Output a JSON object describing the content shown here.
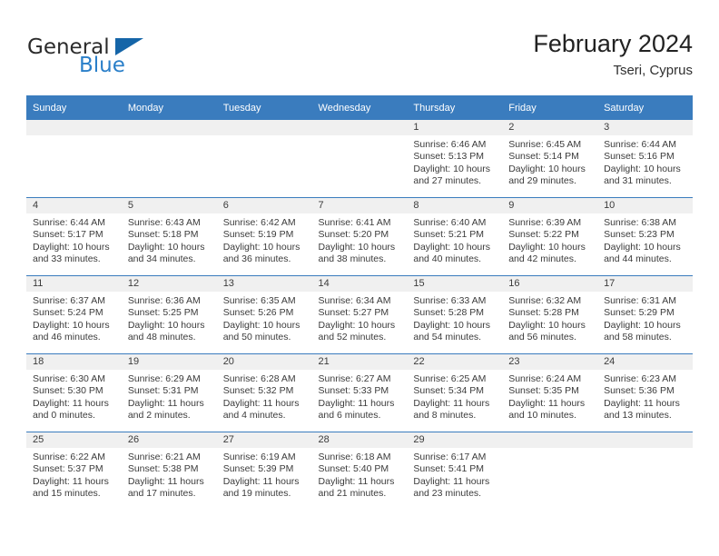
{
  "brand": {
    "word_one": "General",
    "word_two": "Blue",
    "logo_icon": "triangle-logo-icon",
    "accent_color": "#2a7fc9",
    "triangle_color": "#1565a8"
  },
  "header": {
    "title": "February 2024",
    "location": "Tseri, Cyprus"
  },
  "calendar": {
    "header_bg": "#3a7cbe",
    "daynum_bg": "#f0f0f0",
    "weekdays": [
      "Sunday",
      "Monday",
      "Tuesday",
      "Wednesday",
      "Thursday",
      "Friday",
      "Saturday"
    ],
    "weeks": [
      [
        {
          "day": "",
          "blank": true
        },
        {
          "day": "",
          "blank": true
        },
        {
          "day": "",
          "blank": true
        },
        {
          "day": "",
          "blank": true
        },
        {
          "day": "1",
          "sunrise": "Sunrise: 6:46 AM",
          "sunset": "Sunset: 5:13 PM",
          "daylight_line1": "Daylight: 10 hours",
          "daylight_line2": "and 27 minutes."
        },
        {
          "day": "2",
          "sunrise": "Sunrise: 6:45 AM",
          "sunset": "Sunset: 5:14 PM",
          "daylight_line1": "Daylight: 10 hours",
          "daylight_line2": "and 29 minutes."
        },
        {
          "day": "3",
          "sunrise": "Sunrise: 6:44 AM",
          "sunset": "Sunset: 5:16 PM",
          "daylight_line1": "Daylight: 10 hours",
          "daylight_line2": "and 31 minutes."
        }
      ],
      [
        {
          "day": "4",
          "sunrise": "Sunrise: 6:44 AM",
          "sunset": "Sunset: 5:17 PM",
          "daylight_line1": "Daylight: 10 hours",
          "daylight_line2": "and 33 minutes."
        },
        {
          "day": "5",
          "sunrise": "Sunrise: 6:43 AM",
          "sunset": "Sunset: 5:18 PM",
          "daylight_line1": "Daylight: 10 hours",
          "daylight_line2": "and 34 minutes."
        },
        {
          "day": "6",
          "sunrise": "Sunrise: 6:42 AM",
          "sunset": "Sunset: 5:19 PM",
          "daylight_line1": "Daylight: 10 hours",
          "daylight_line2": "and 36 minutes."
        },
        {
          "day": "7",
          "sunrise": "Sunrise: 6:41 AM",
          "sunset": "Sunset: 5:20 PM",
          "daylight_line1": "Daylight: 10 hours",
          "daylight_line2": "and 38 minutes."
        },
        {
          "day": "8",
          "sunrise": "Sunrise: 6:40 AM",
          "sunset": "Sunset: 5:21 PM",
          "daylight_line1": "Daylight: 10 hours",
          "daylight_line2": "and 40 minutes."
        },
        {
          "day": "9",
          "sunrise": "Sunrise: 6:39 AM",
          "sunset": "Sunset: 5:22 PM",
          "daylight_line1": "Daylight: 10 hours",
          "daylight_line2": "and 42 minutes."
        },
        {
          "day": "10",
          "sunrise": "Sunrise: 6:38 AM",
          "sunset": "Sunset: 5:23 PM",
          "daylight_line1": "Daylight: 10 hours",
          "daylight_line2": "and 44 minutes."
        }
      ],
      [
        {
          "day": "11",
          "sunrise": "Sunrise: 6:37 AM",
          "sunset": "Sunset: 5:24 PM",
          "daylight_line1": "Daylight: 10 hours",
          "daylight_line2": "and 46 minutes."
        },
        {
          "day": "12",
          "sunrise": "Sunrise: 6:36 AM",
          "sunset": "Sunset: 5:25 PM",
          "daylight_line1": "Daylight: 10 hours",
          "daylight_line2": "and 48 minutes."
        },
        {
          "day": "13",
          "sunrise": "Sunrise: 6:35 AM",
          "sunset": "Sunset: 5:26 PM",
          "daylight_line1": "Daylight: 10 hours",
          "daylight_line2": "and 50 minutes."
        },
        {
          "day": "14",
          "sunrise": "Sunrise: 6:34 AM",
          "sunset": "Sunset: 5:27 PM",
          "daylight_line1": "Daylight: 10 hours",
          "daylight_line2": "and 52 minutes."
        },
        {
          "day": "15",
          "sunrise": "Sunrise: 6:33 AM",
          "sunset": "Sunset: 5:28 PM",
          "daylight_line1": "Daylight: 10 hours",
          "daylight_line2": "and 54 minutes."
        },
        {
          "day": "16",
          "sunrise": "Sunrise: 6:32 AM",
          "sunset": "Sunset: 5:28 PM",
          "daylight_line1": "Daylight: 10 hours",
          "daylight_line2": "and 56 minutes."
        },
        {
          "day": "17",
          "sunrise": "Sunrise: 6:31 AM",
          "sunset": "Sunset: 5:29 PM",
          "daylight_line1": "Daylight: 10 hours",
          "daylight_line2": "and 58 minutes."
        }
      ],
      [
        {
          "day": "18",
          "sunrise": "Sunrise: 6:30 AM",
          "sunset": "Sunset: 5:30 PM",
          "daylight_line1": "Daylight: 11 hours",
          "daylight_line2": "and 0 minutes."
        },
        {
          "day": "19",
          "sunrise": "Sunrise: 6:29 AM",
          "sunset": "Sunset: 5:31 PM",
          "daylight_line1": "Daylight: 11 hours",
          "daylight_line2": "and 2 minutes."
        },
        {
          "day": "20",
          "sunrise": "Sunrise: 6:28 AM",
          "sunset": "Sunset: 5:32 PM",
          "daylight_line1": "Daylight: 11 hours",
          "daylight_line2": "and 4 minutes."
        },
        {
          "day": "21",
          "sunrise": "Sunrise: 6:27 AM",
          "sunset": "Sunset: 5:33 PM",
          "daylight_line1": "Daylight: 11 hours",
          "daylight_line2": "and 6 minutes."
        },
        {
          "day": "22",
          "sunrise": "Sunrise: 6:25 AM",
          "sunset": "Sunset: 5:34 PM",
          "daylight_line1": "Daylight: 11 hours",
          "daylight_line2": "and 8 minutes."
        },
        {
          "day": "23",
          "sunrise": "Sunrise: 6:24 AM",
          "sunset": "Sunset: 5:35 PM",
          "daylight_line1": "Daylight: 11 hours",
          "daylight_line2": "and 10 minutes."
        },
        {
          "day": "24",
          "sunrise": "Sunrise: 6:23 AM",
          "sunset": "Sunset: 5:36 PM",
          "daylight_line1": "Daylight: 11 hours",
          "daylight_line2": "and 13 minutes."
        }
      ],
      [
        {
          "day": "25",
          "sunrise": "Sunrise: 6:22 AM",
          "sunset": "Sunset: 5:37 PM",
          "daylight_line1": "Daylight: 11 hours",
          "daylight_line2": "and 15 minutes."
        },
        {
          "day": "26",
          "sunrise": "Sunrise: 6:21 AM",
          "sunset": "Sunset: 5:38 PM",
          "daylight_line1": "Daylight: 11 hours",
          "daylight_line2": "and 17 minutes."
        },
        {
          "day": "27",
          "sunrise": "Sunrise: 6:19 AM",
          "sunset": "Sunset: 5:39 PM",
          "daylight_line1": "Daylight: 11 hours",
          "daylight_line2": "and 19 minutes."
        },
        {
          "day": "28",
          "sunrise": "Sunrise: 6:18 AM",
          "sunset": "Sunset: 5:40 PM",
          "daylight_line1": "Daylight: 11 hours",
          "daylight_line2": "and 21 minutes."
        },
        {
          "day": "29",
          "sunrise": "Sunrise: 6:17 AM",
          "sunset": "Sunset: 5:41 PM",
          "daylight_line1": "Daylight: 11 hours",
          "daylight_line2": "and 23 minutes."
        },
        {
          "day": "",
          "blank": true
        },
        {
          "day": "",
          "blank": true
        }
      ]
    ]
  }
}
